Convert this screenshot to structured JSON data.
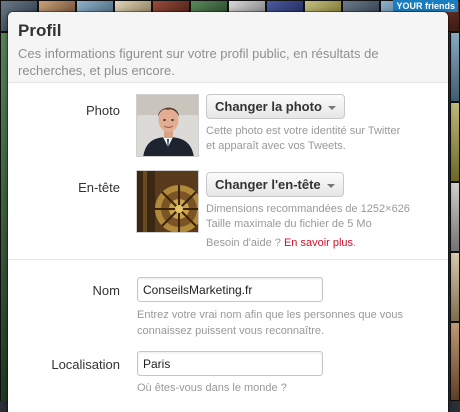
{
  "background": {
    "promo_text": "YOUR friends"
  },
  "modal": {
    "title": "Profil",
    "subtitle": "Ces informations figurent sur votre profil public, en résultats de recherches, et plus encore."
  },
  "photo": {
    "label": "Photo",
    "button": "Changer la photo",
    "help": "Cette photo est votre identité sur Twitter et apparaît avec vos Tweets."
  },
  "header_image": {
    "label": "En-tête",
    "button": "Changer l'en-tête",
    "help_line1": "Dimensions recommandées de 1252×626",
    "help_line2": "Taille maximale du fichier de 5 Mo",
    "help_prefix": "Besoin d'aide ?",
    "help_link": "En savoir plus",
    "help_suffix": "."
  },
  "name_field": {
    "label": "Nom",
    "value": "ConseilsMarketing.fr",
    "help": "Entrez votre vrai nom afin que les personnes que vous connaissez puissent vous reconnaître."
  },
  "location_field": {
    "label": "Localisation",
    "value": "Paris",
    "help": "Où êtes-vous dans le monde ?"
  },
  "colors": {
    "link": "#d0102a",
    "muted": "#999999",
    "header_bg": "#f5f5f5"
  }
}
